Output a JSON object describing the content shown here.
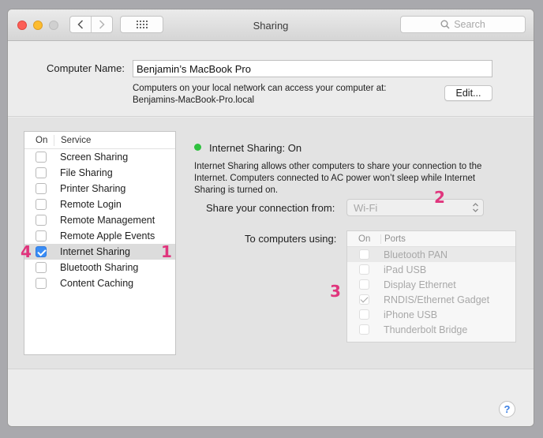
{
  "window": {
    "title": "Sharing"
  },
  "toolbar": {
    "search_placeholder": "Search"
  },
  "computer_name": {
    "label": "Computer Name:",
    "value": "Benjamin’s MacBook Pro",
    "info_line1": "Computers on your local network can access your computer at:",
    "info_line2": "Benjamins-MacBook-Pro.local",
    "edit_label": "Edit..."
  },
  "services": {
    "header_on": "On",
    "header_service": "Service",
    "items": [
      {
        "label": "Screen Sharing",
        "checked": false
      },
      {
        "label": "File Sharing",
        "checked": false
      },
      {
        "label": "Printer Sharing",
        "checked": false
      },
      {
        "label": "Remote Login",
        "checked": false
      },
      {
        "label": "Remote Management",
        "checked": false
      },
      {
        "label": "Remote Apple Events",
        "checked": false
      },
      {
        "label": "Internet Sharing",
        "checked": true,
        "selected": true
      },
      {
        "label": "Bluetooth Sharing",
        "checked": false
      },
      {
        "label": "Content Caching",
        "checked": false
      }
    ]
  },
  "detail": {
    "status_title": "Internet Sharing: On",
    "status_color": "#2fc13f",
    "description": "Internet Sharing allows other computers to share your connection to the Internet. Computers connected to AC power won’t sleep while Internet Sharing is turned on.",
    "share_from_label": "Share your connection from:",
    "share_from_value": "Wi-Fi",
    "to_computers_label": "To computers using:",
    "ports_header_on": "On",
    "ports_header_ports": "Ports",
    "ports": [
      {
        "label": "Bluetooth PAN",
        "checked": false
      },
      {
        "label": "iPad USB",
        "checked": false
      },
      {
        "label": "Display Ethernet",
        "checked": false
      },
      {
        "label": "RNDIS/Ethernet Gadget",
        "checked": true
      },
      {
        "label": "iPhone USB",
        "checked": false
      },
      {
        "label": "Thunderbolt Bridge",
        "checked": false
      }
    ]
  },
  "help": {
    "label": "?"
  },
  "annotations": {
    "one": "1",
    "two": "2",
    "three": "3",
    "four": "4",
    "color": "#e0357d"
  }
}
